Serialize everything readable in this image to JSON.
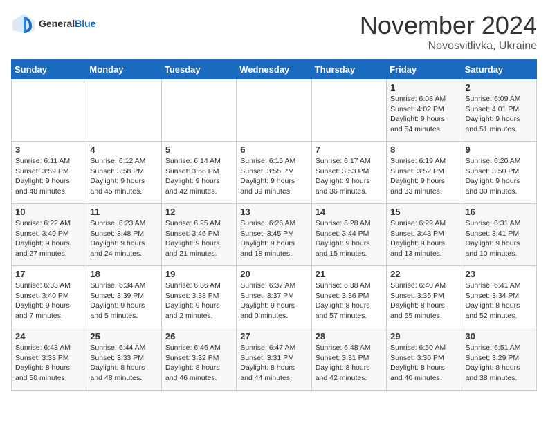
{
  "logo": {
    "general": "General",
    "blue": "Blue"
  },
  "header": {
    "month": "November 2024",
    "location": "Novosvitlivka, Ukraine"
  },
  "weekdays": [
    "Sunday",
    "Monday",
    "Tuesday",
    "Wednesday",
    "Thursday",
    "Friday",
    "Saturday"
  ],
  "weeks": [
    [
      {
        "day": "",
        "info": ""
      },
      {
        "day": "",
        "info": ""
      },
      {
        "day": "",
        "info": ""
      },
      {
        "day": "",
        "info": ""
      },
      {
        "day": "",
        "info": ""
      },
      {
        "day": "1",
        "info": "Sunrise: 6:08 AM\nSunset: 4:02 PM\nDaylight: 9 hours\nand 54 minutes."
      },
      {
        "day": "2",
        "info": "Sunrise: 6:09 AM\nSunset: 4:01 PM\nDaylight: 9 hours\nand 51 minutes."
      }
    ],
    [
      {
        "day": "3",
        "info": "Sunrise: 6:11 AM\nSunset: 3:59 PM\nDaylight: 9 hours\nand 48 minutes."
      },
      {
        "day": "4",
        "info": "Sunrise: 6:12 AM\nSunset: 3:58 PM\nDaylight: 9 hours\nand 45 minutes."
      },
      {
        "day": "5",
        "info": "Sunrise: 6:14 AM\nSunset: 3:56 PM\nDaylight: 9 hours\nand 42 minutes."
      },
      {
        "day": "6",
        "info": "Sunrise: 6:15 AM\nSunset: 3:55 PM\nDaylight: 9 hours\nand 39 minutes."
      },
      {
        "day": "7",
        "info": "Sunrise: 6:17 AM\nSunset: 3:53 PM\nDaylight: 9 hours\nand 36 minutes."
      },
      {
        "day": "8",
        "info": "Sunrise: 6:19 AM\nSunset: 3:52 PM\nDaylight: 9 hours\nand 33 minutes."
      },
      {
        "day": "9",
        "info": "Sunrise: 6:20 AM\nSunset: 3:50 PM\nDaylight: 9 hours\nand 30 minutes."
      }
    ],
    [
      {
        "day": "10",
        "info": "Sunrise: 6:22 AM\nSunset: 3:49 PM\nDaylight: 9 hours\nand 27 minutes."
      },
      {
        "day": "11",
        "info": "Sunrise: 6:23 AM\nSunset: 3:48 PM\nDaylight: 9 hours\nand 24 minutes."
      },
      {
        "day": "12",
        "info": "Sunrise: 6:25 AM\nSunset: 3:46 PM\nDaylight: 9 hours\nand 21 minutes."
      },
      {
        "day": "13",
        "info": "Sunrise: 6:26 AM\nSunset: 3:45 PM\nDaylight: 9 hours\nand 18 minutes."
      },
      {
        "day": "14",
        "info": "Sunrise: 6:28 AM\nSunset: 3:44 PM\nDaylight: 9 hours\nand 15 minutes."
      },
      {
        "day": "15",
        "info": "Sunrise: 6:29 AM\nSunset: 3:43 PM\nDaylight: 9 hours\nand 13 minutes."
      },
      {
        "day": "16",
        "info": "Sunrise: 6:31 AM\nSunset: 3:41 PM\nDaylight: 9 hours\nand 10 minutes."
      }
    ],
    [
      {
        "day": "17",
        "info": "Sunrise: 6:33 AM\nSunset: 3:40 PM\nDaylight: 9 hours\nand 7 minutes."
      },
      {
        "day": "18",
        "info": "Sunrise: 6:34 AM\nSunset: 3:39 PM\nDaylight: 9 hours\nand 5 minutes."
      },
      {
        "day": "19",
        "info": "Sunrise: 6:36 AM\nSunset: 3:38 PM\nDaylight: 9 hours\nand 2 minutes."
      },
      {
        "day": "20",
        "info": "Sunrise: 6:37 AM\nSunset: 3:37 PM\nDaylight: 9 hours\nand 0 minutes."
      },
      {
        "day": "21",
        "info": "Sunrise: 6:38 AM\nSunset: 3:36 PM\nDaylight: 8 hours\nand 57 minutes."
      },
      {
        "day": "22",
        "info": "Sunrise: 6:40 AM\nSunset: 3:35 PM\nDaylight: 8 hours\nand 55 minutes."
      },
      {
        "day": "23",
        "info": "Sunrise: 6:41 AM\nSunset: 3:34 PM\nDaylight: 8 hours\nand 52 minutes."
      }
    ],
    [
      {
        "day": "24",
        "info": "Sunrise: 6:43 AM\nSunset: 3:33 PM\nDaylight: 8 hours\nand 50 minutes."
      },
      {
        "day": "25",
        "info": "Sunrise: 6:44 AM\nSunset: 3:33 PM\nDaylight: 8 hours\nand 48 minutes."
      },
      {
        "day": "26",
        "info": "Sunrise: 6:46 AM\nSunset: 3:32 PM\nDaylight: 8 hours\nand 46 minutes."
      },
      {
        "day": "27",
        "info": "Sunrise: 6:47 AM\nSunset: 3:31 PM\nDaylight: 8 hours\nand 44 minutes."
      },
      {
        "day": "28",
        "info": "Sunrise: 6:48 AM\nSunset: 3:31 PM\nDaylight: 8 hours\nand 42 minutes."
      },
      {
        "day": "29",
        "info": "Sunrise: 6:50 AM\nSunset: 3:30 PM\nDaylight: 8 hours\nand 40 minutes."
      },
      {
        "day": "30",
        "info": "Sunrise: 6:51 AM\nSunset: 3:29 PM\nDaylight: 8 hours\nand 38 minutes."
      }
    ]
  ]
}
